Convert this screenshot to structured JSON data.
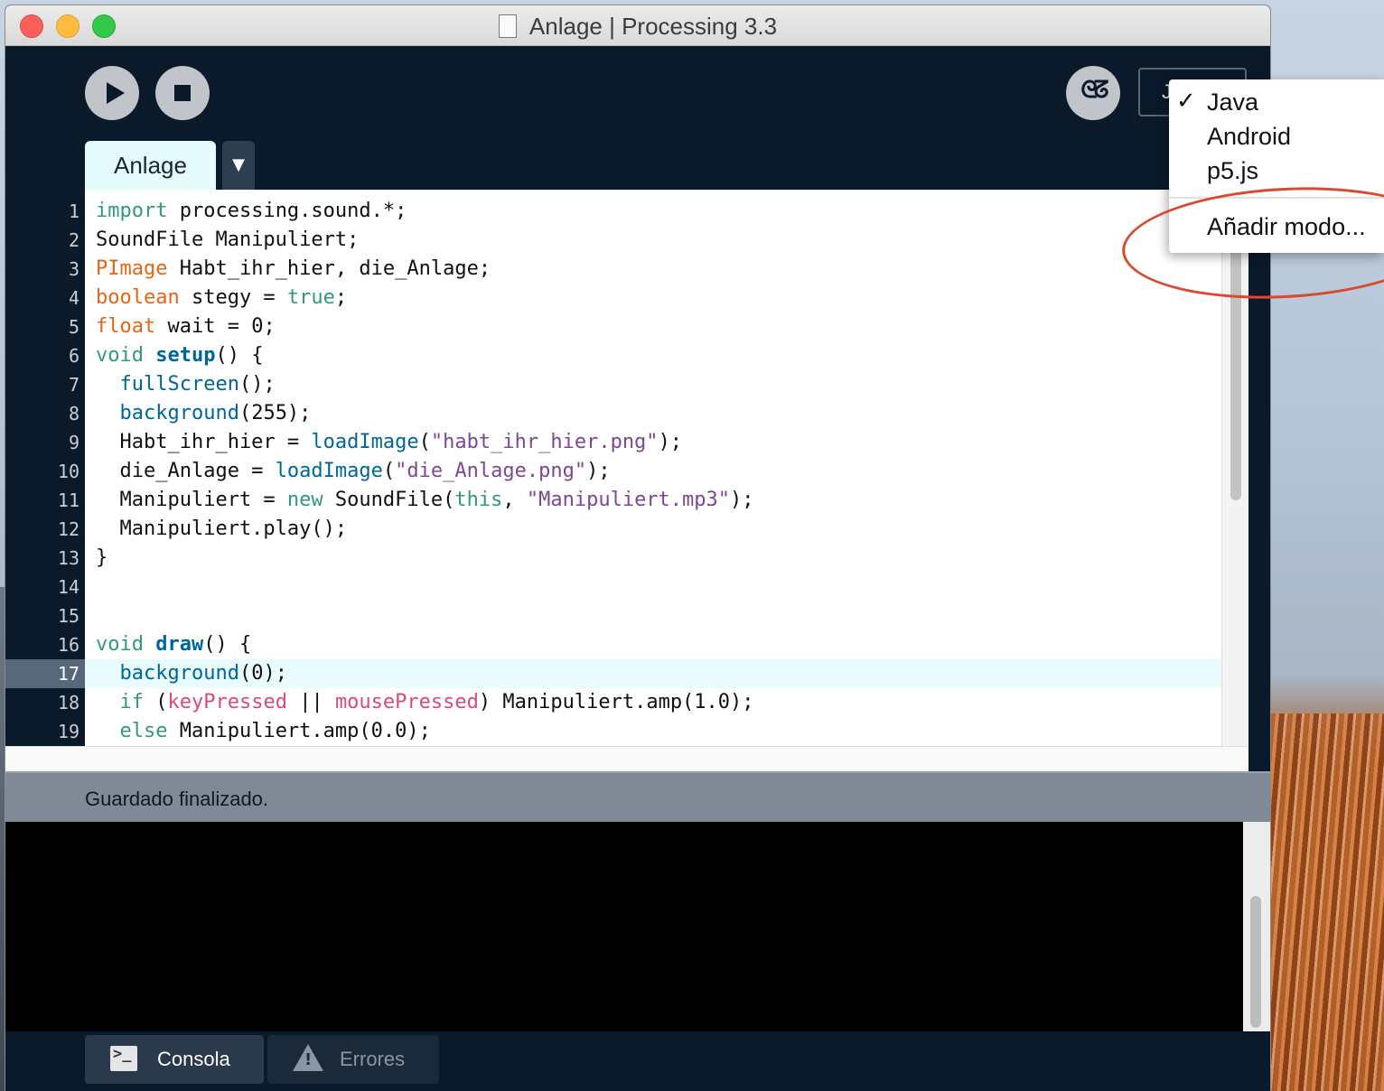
{
  "window": {
    "title": "Anlage | Processing 3.3"
  },
  "toolbar": {
    "mode_label": "J"
  },
  "tabs": {
    "active_tab": "Anlage",
    "menu_arrow": "▼"
  },
  "mode_menu": {
    "check_mark": "✓",
    "items": [
      "Java",
      "Android",
      "p5.js"
    ],
    "add_mode": "Añadir modo..."
  },
  "editor": {
    "current_line": 17,
    "lines": [
      "import processing.sound.*;",
      "SoundFile Manipuliert;",
      "PImage Habt_ihr_hier, die_Anlage;",
      "boolean stegy = true;",
      "float wait = 0;",
      "void setup() {",
      "  fullScreen();",
      "  background(255);",
      "  Habt_ihr_hier = loadImage(\"habt_ihr_hier.png\");",
      "  die_Anlage = loadImage(\"die_Anlage.png\");",
      "  Manipuliert = new SoundFile(this, \"Manipuliert.mp3\");",
      "  Manipuliert.play();",
      "}",
      "",
      "",
      "void draw() {",
      "  background(0);",
      "  if (keyPressed || mousePressed) Manipuliert.amp(1.0);",
      "  else Manipuliert.amp(0.0);"
    ]
  },
  "status": {
    "message": "Guardado finalizado."
  },
  "footer": {
    "console_label": "Consola",
    "errors_label": "Errores"
  },
  "colors": {
    "keyword": "#33997e",
    "type": "#e2661a",
    "function": "#006699",
    "string": "#7d4793",
    "annotation": "#d94a2e"
  }
}
